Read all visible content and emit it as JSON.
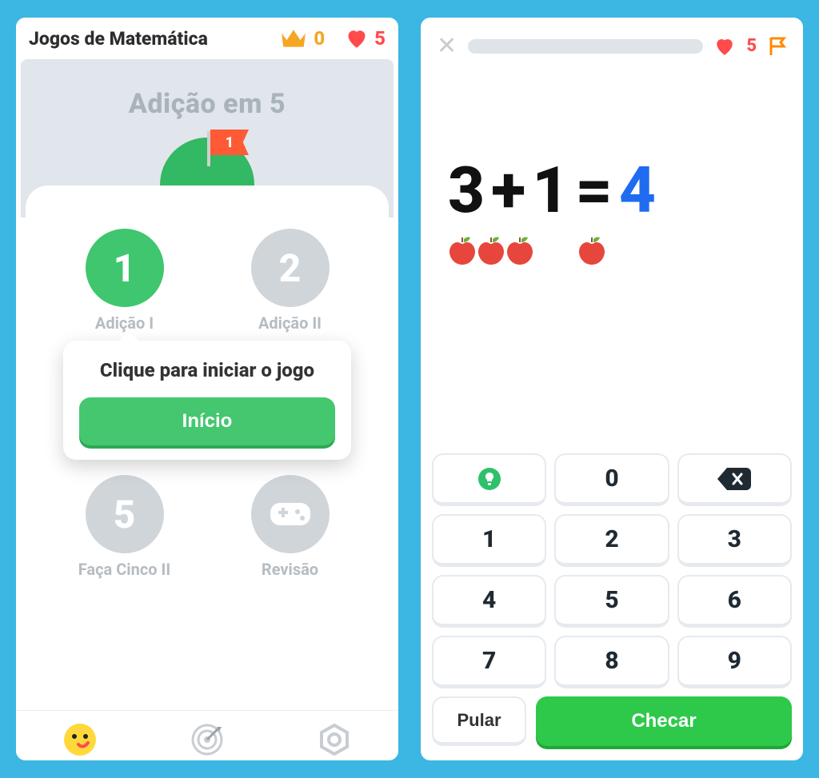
{
  "left": {
    "topbar": {
      "title": "Jogos de Matemática",
      "crown_count": "0",
      "heart_count": "5"
    },
    "hero": {
      "section_title": "Adição em 5",
      "flag_number": "1"
    },
    "levels": [
      {
        "num": "1",
        "label": "Adição I",
        "state": "active"
      },
      {
        "num": "2",
        "label": "Adição II",
        "state": "inactive"
      },
      {
        "num": "5",
        "label": "Faça Cinco II",
        "state": "inactive"
      },
      {
        "icon": "gamepad",
        "label": "Revisão",
        "state": "inactive"
      }
    ],
    "popover": {
      "text": "Clique para iniciar o jogo",
      "button": "Início"
    }
  },
  "right": {
    "topbar": {
      "heart_count": "5"
    },
    "equation": {
      "a": "3",
      "op": "+",
      "b": "1",
      "eq": "=",
      "answer": "4",
      "apples_a": 3,
      "apples_b": 1
    },
    "keypad": {
      "row1": [
        "hint",
        "0",
        "backspace"
      ],
      "rows": [
        [
          "1",
          "2",
          "3"
        ],
        [
          "4",
          "5",
          "6"
        ],
        [
          "7",
          "8",
          "9"
        ]
      ],
      "skip": "Pular",
      "check": "Checar"
    }
  }
}
